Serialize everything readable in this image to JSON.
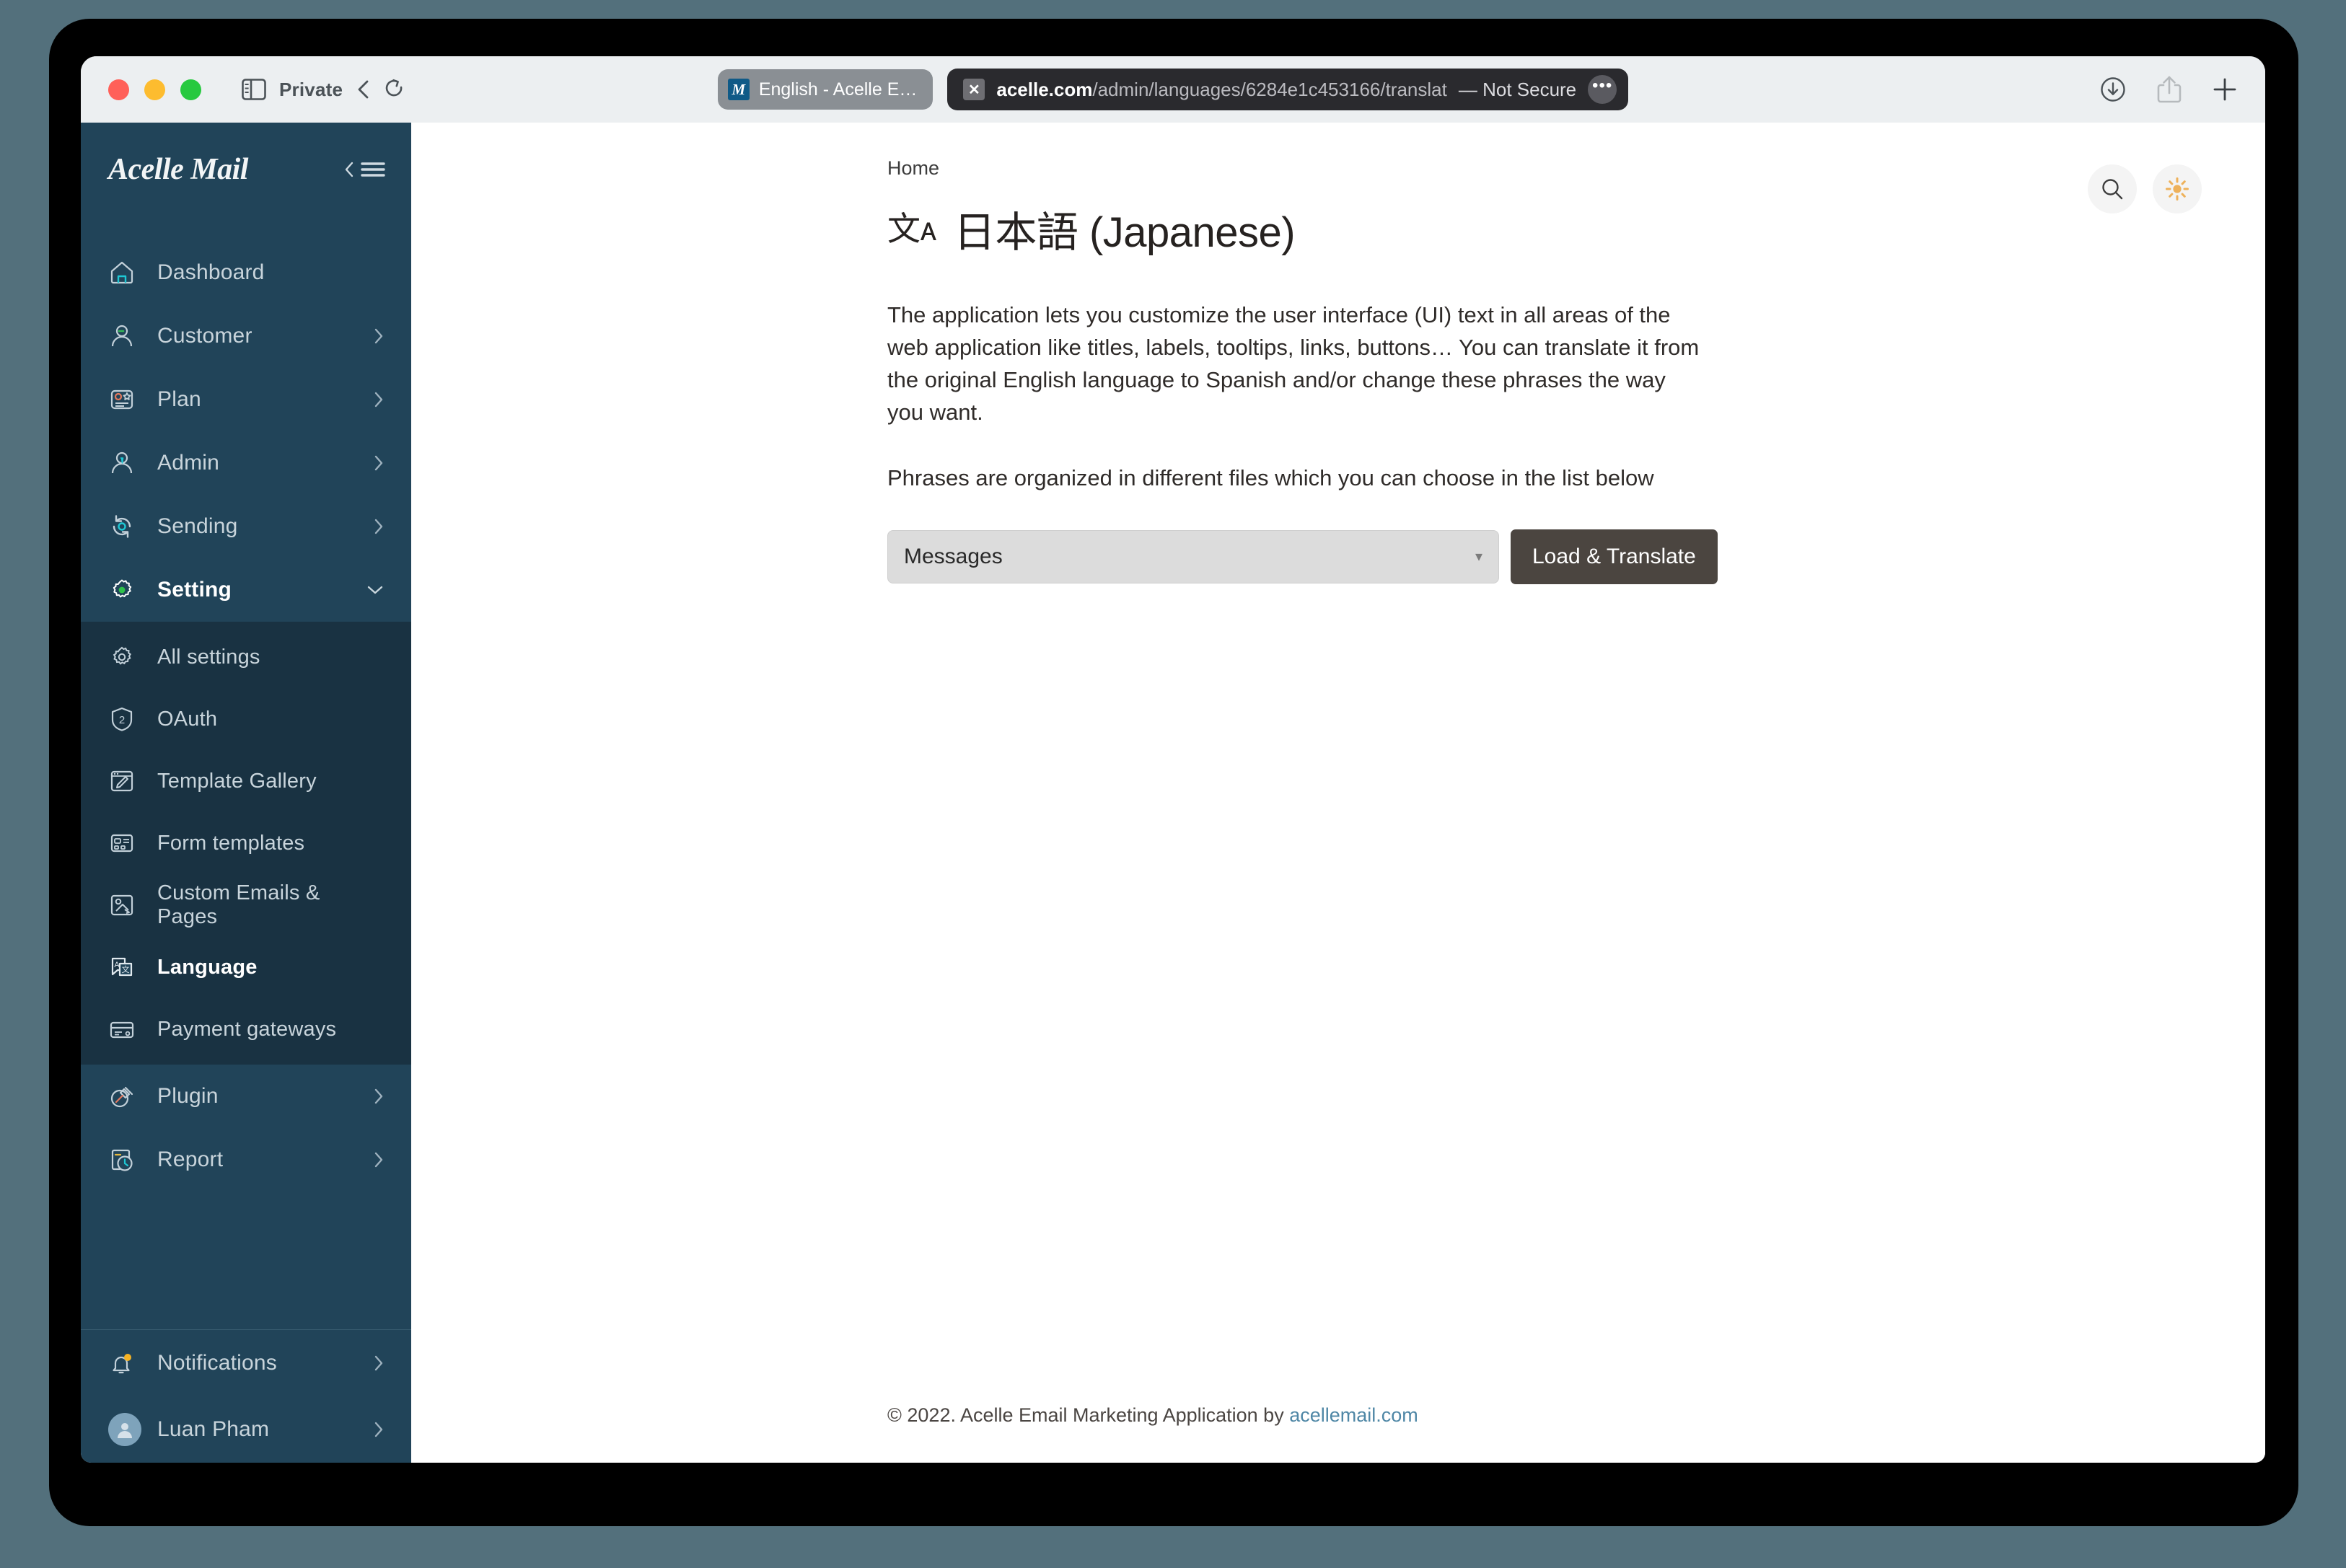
{
  "browser": {
    "private_label": "Private",
    "tab": {
      "favicon_letter": "M",
      "title": "English - Acelle E…"
    },
    "url": {
      "host": "acelle.com",
      "path": "/admin/languages/6284e1c453166/translat",
      "security": "— Not Secure",
      "blocker_glyph": "✕",
      "menu_glyph": "•••"
    }
  },
  "sidebar": {
    "brand": "Acelle Mail",
    "items": [
      {
        "label": "Dashboard",
        "icon": "home-icon",
        "has_arrow": false
      },
      {
        "label": "Customer",
        "icon": "user-icon",
        "has_arrow": true
      },
      {
        "label": "Plan",
        "icon": "plan-card-icon",
        "has_arrow": true
      },
      {
        "label": "Admin",
        "icon": "admin-user-icon",
        "has_arrow": true
      },
      {
        "label": "Sending",
        "icon": "sending-sync-icon",
        "has_arrow": true
      },
      {
        "label": "Setting",
        "icon": "gear-icon",
        "has_arrow": true,
        "expanded": true
      }
    ],
    "submenu": [
      {
        "label": "All settings",
        "icon": "settings-gear-icon"
      },
      {
        "label": "OAuth",
        "icon": "shield-two-icon"
      },
      {
        "label": "Template Gallery",
        "icon": "template-brush-icon"
      },
      {
        "label": "Form templates",
        "icon": "form-layout-icon"
      },
      {
        "label": "Custom Emails & Pages",
        "icon": "custom-pages-icon"
      },
      {
        "label": "Language",
        "icon": "translate-icon",
        "current": true
      },
      {
        "label": "Payment gateways",
        "icon": "credit-card-icon"
      }
    ],
    "items_after": [
      {
        "label": "Plugin",
        "icon": "plug-icon",
        "has_arrow": true
      },
      {
        "label": "Report",
        "icon": "report-clock-icon",
        "has_arrow": true
      }
    ],
    "footer": [
      {
        "label": "Notifications",
        "icon": "bell-icon",
        "has_arrow": true,
        "badge": true
      },
      {
        "label": "Luan Pham",
        "icon": "avatar",
        "has_arrow": true
      }
    ]
  },
  "main": {
    "breadcrumb": "Home",
    "title": "日本語 (Japanese)",
    "title_icon": "文ᴀ",
    "intro_paragraph": "The application lets you customize the user interface (UI) text in all areas of the web application like titles, labels, tooltips, links, buttons… You can translate it from the original English language to Spanish and/or change these phrases the way you want.",
    "second_paragraph": "Phrases are organized in different files which you can choose in the list below",
    "select_value": "Messages",
    "select_caret": "▾",
    "load_button": "Load & Translate",
    "footer_text": "© 2022. Acelle Email Marketing Application by ",
    "footer_link": "acellemail.com"
  },
  "colors": {
    "sidebar_bg": "#214459",
    "submenu_bg": "#193242",
    "accent_button": "#4b4540",
    "link": "#4f87a6",
    "notification_badge": "#f5b324",
    "theme_sun": "#eeb15a"
  }
}
